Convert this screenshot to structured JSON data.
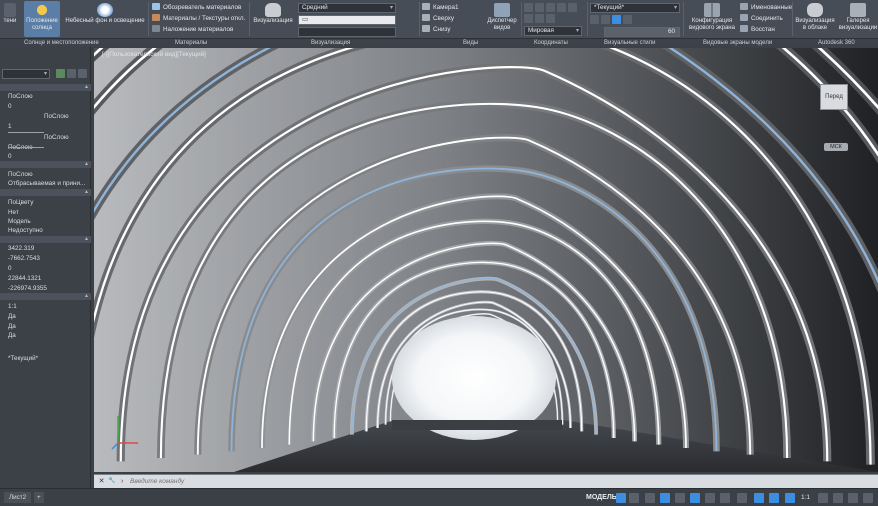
{
  "ribbon": {
    "left_cut_label": "тени",
    "sun_position": "Положение солнца",
    "sky": "Небесный фон и освещение",
    "materials_browser": "Обозреватель материалов",
    "materials_textures": "Материалы / Текстуры откл.",
    "materials_mapping": "Наложение материалов",
    "visualize": "Визуализация",
    "render_quality": "Средний",
    "camera1": "Камера1",
    "top_view": "Сверху",
    "bottom_view": "Снизу",
    "view_manager": "Диспетчер видов",
    "ucs_world": "Мировая",
    "visual_style": "*Текущий*",
    "zoom_value": "60",
    "viewport_config": "Конфигурация видового экрана",
    "named": "Именованные",
    "join": "Соединить",
    "restore": "Восстан",
    "cloud_render": "Визуализация в облаке",
    "render_gallery": "Галерея визуализации",
    "groups": {
      "sun": "Солнце и местоположение",
      "materials": "Материалы",
      "visualize": "Визуализация",
      "views": "Виды",
      "coordinates": "Координаты",
      "visual_styles": "Визуальные стили",
      "model_viewports": "Видовые экраны модели",
      "a360": "Autodesk 360"
    }
  },
  "properties": {
    "rows": [
      "ПоСлою",
      "0",
      "ПоСлою",
      "1",
      "ПоСлою",
      "ПоСлою",
      "0",
      "ПоСлою",
      "Отбрасываемая и прини...",
      "ПоЦвету",
      "Нет",
      "Модель",
      "Недоступно",
      "3422.319",
      "-7662.7543",
      "0",
      "22844.1321",
      "-226974.9355",
      "1:1",
      "Да",
      "Да",
      "Да",
      "*Текущий*"
    ]
  },
  "viewport": {
    "label": "[-][Пользовательский вид][Текущий]",
    "viewcube_face": "Перед",
    "wcs": "МСК"
  },
  "command": {
    "placeholder": "Введите команду"
  },
  "status": {
    "sheet_tab": "Лист2",
    "add_tab": "+",
    "model": "МОДЕЛЬ",
    "scale": "1:1"
  },
  "colors": {
    "ribbon_bg": "#474d56",
    "panel_bg": "#3c4148",
    "accent_blue": "#3b8ee0",
    "sun_yellow": "#f2c94c"
  }
}
